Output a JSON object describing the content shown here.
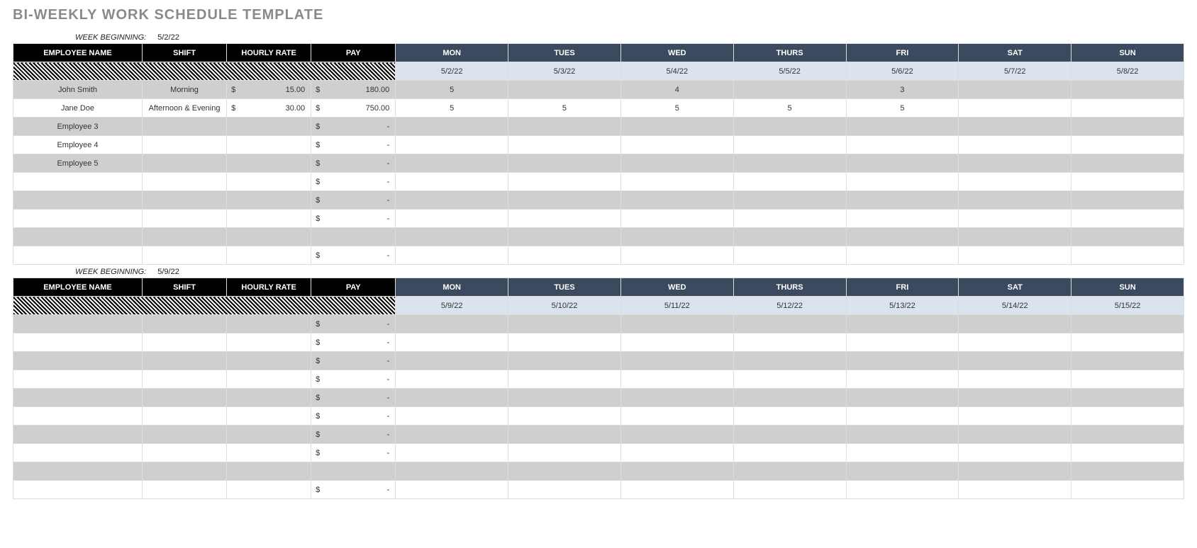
{
  "title": "BI-WEEKLY WORK SCHEDULE TEMPLATE",
  "weekBeginningLabel": "WEEK BEGINNING:",
  "headers": {
    "name": "EMPLOYEE NAME",
    "shift": "SHIFT",
    "rate": "HOURLY RATE",
    "pay": "PAY",
    "days": [
      "MON",
      "TUES",
      "WED",
      "THURS",
      "FRI",
      "SAT",
      "SUN"
    ]
  },
  "currency": "$",
  "weeks": [
    {
      "beginning": "5/2/22",
      "dates": [
        "5/2/22",
        "5/3/22",
        "5/4/22",
        "5/5/22",
        "5/6/22",
        "5/7/22",
        "5/8/22"
      ],
      "rows": [
        {
          "name": "John Smith",
          "shift": "Morning",
          "rate": "15.00",
          "pay": "180.00",
          "days": [
            "5",
            "",
            "4",
            "",
            "3",
            "",
            ""
          ]
        },
        {
          "name": "Jane Doe",
          "shift": "Afternoon & Evening",
          "rate": "30.00",
          "pay": "750.00",
          "days": [
            "5",
            "5",
            "5",
            "5",
            "5",
            "",
            ""
          ]
        },
        {
          "name": "Employee 3",
          "shift": "",
          "rate": "",
          "pay": "-",
          "days": [
            "",
            "",
            "",
            "",
            "",
            "",
            ""
          ]
        },
        {
          "name": "Employee 4",
          "shift": "",
          "rate": "",
          "pay": "-",
          "days": [
            "",
            "",
            "",
            "",
            "",
            "",
            ""
          ]
        },
        {
          "name": "Employee 5",
          "shift": "",
          "rate": "",
          "pay": "-",
          "days": [
            "",
            "",
            "",
            "",
            "",
            "",
            ""
          ]
        },
        {
          "name": "",
          "shift": "",
          "rate": "",
          "pay": "-",
          "days": [
            "",
            "",
            "",
            "",
            "",
            "",
            ""
          ]
        },
        {
          "name": "",
          "shift": "",
          "rate": "",
          "pay": "-",
          "days": [
            "",
            "",
            "",
            "",
            "",
            "",
            ""
          ]
        },
        {
          "name": "",
          "shift": "",
          "rate": "",
          "pay": "-",
          "days": [
            "",
            "",
            "",
            "",
            "",
            "",
            ""
          ]
        },
        {
          "name": "",
          "shift": "",
          "rate": "",
          "pay": "",
          "days": [
            "",
            "",
            "",
            "",
            "",
            "",
            ""
          ]
        },
        {
          "name": "",
          "shift": "",
          "rate": "",
          "pay": "-",
          "days": [
            "",
            "",
            "",
            "",
            "",
            "",
            ""
          ]
        }
      ]
    },
    {
      "beginning": "5/9/22",
      "dates": [
        "5/9/22",
        "5/10/22",
        "5/11/22",
        "5/12/22",
        "5/13/22",
        "5/14/22",
        "5/15/22"
      ],
      "rows": [
        {
          "name": "",
          "shift": "",
          "rate": "",
          "pay": "-",
          "days": [
            "",
            "",
            "",
            "",
            "",
            "",
            ""
          ]
        },
        {
          "name": "",
          "shift": "",
          "rate": "",
          "pay": "-",
          "days": [
            "",
            "",
            "",
            "",
            "",
            "",
            ""
          ]
        },
        {
          "name": "",
          "shift": "",
          "rate": "",
          "pay": "-",
          "days": [
            "",
            "",
            "",
            "",
            "",
            "",
            ""
          ]
        },
        {
          "name": "",
          "shift": "",
          "rate": "",
          "pay": "-",
          "days": [
            "",
            "",
            "",
            "",
            "",
            "",
            ""
          ]
        },
        {
          "name": "",
          "shift": "",
          "rate": "",
          "pay": "-",
          "days": [
            "",
            "",
            "",
            "",
            "",
            "",
            ""
          ]
        },
        {
          "name": "",
          "shift": "",
          "rate": "",
          "pay": "-",
          "days": [
            "",
            "",
            "",
            "",
            "",
            "",
            ""
          ]
        },
        {
          "name": "",
          "shift": "",
          "rate": "",
          "pay": "-",
          "days": [
            "",
            "",
            "",
            "",
            "",
            "",
            ""
          ]
        },
        {
          "name": "",
          "shift": "",
          "rate": "",
          "pay": "-",
          "days": [
            "",
            "",
            "",
            "",
            "",
            "",
            ""
          ]
        },
        {
          "name": "",
          "shift": "",
          "rate": "",
          "pay": "",
          "days": [
            "",
            "",
            "",
            "",
            "",
            "",
            ""
          ]
        },
        {
          "name": "",
          "shift": "",
          "rate": "",
          "pay": "-",
          "days": [
            "",
            "",
            "",
            "",
            "",
            "",
            ""
          ]
        }
      ]
    }
  ]
}
